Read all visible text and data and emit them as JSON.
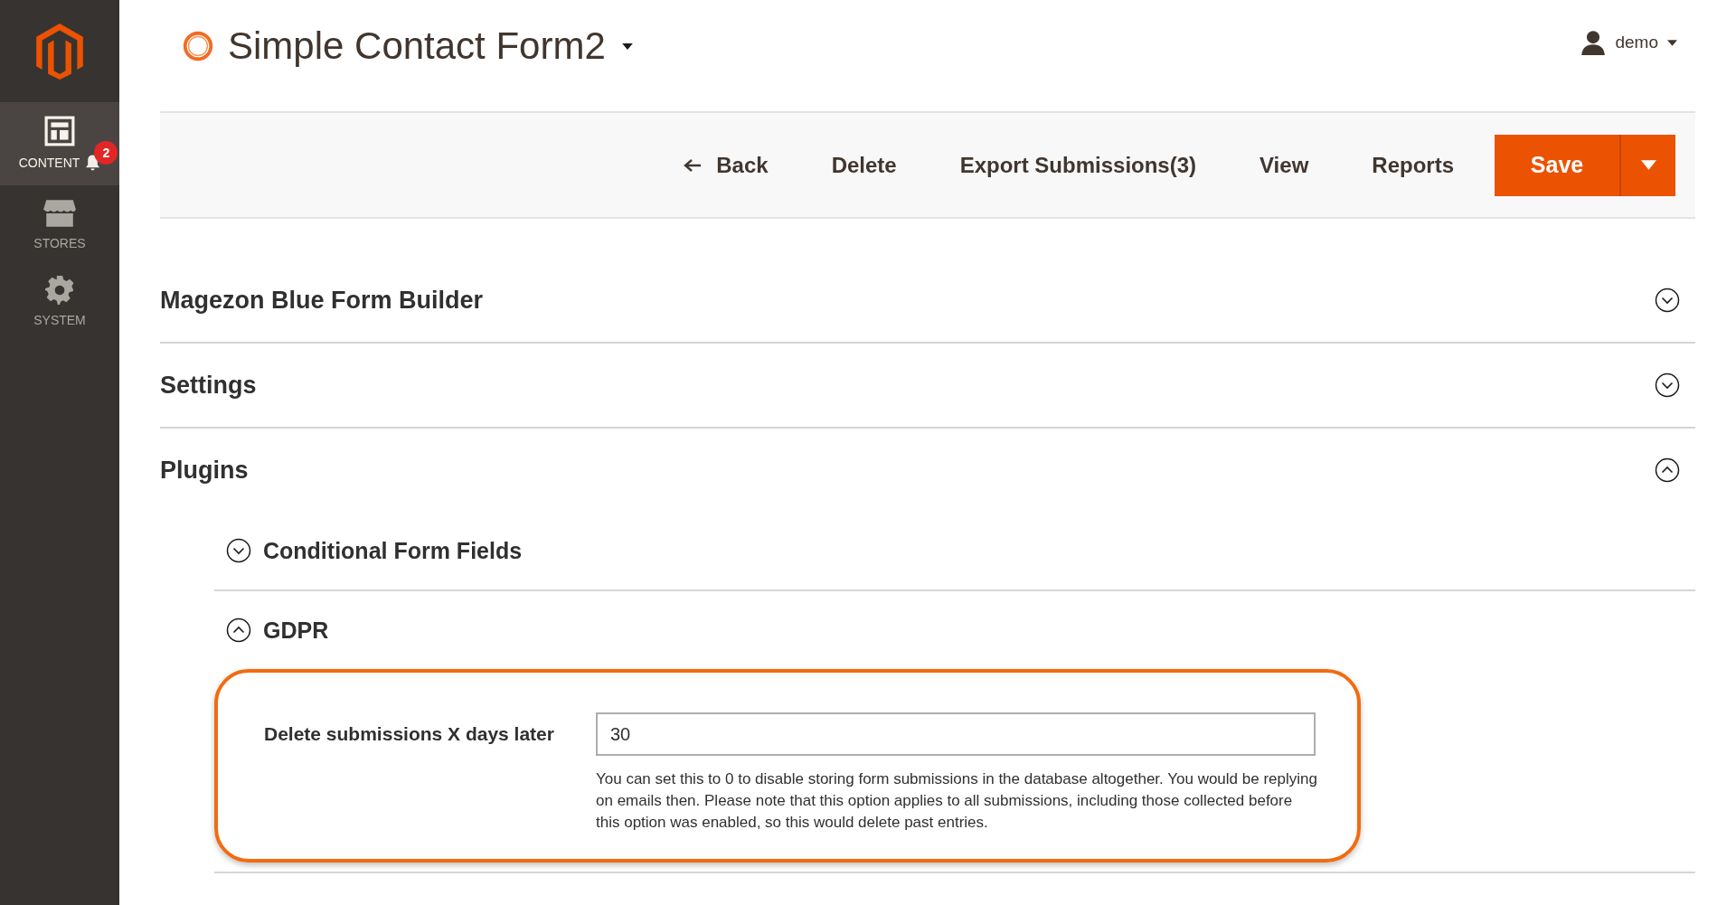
{
  "sidebar": {
    "items": [
      {
        "kind": "content",
        "label": "CONTENT",
        "selected": true,
        "badge": "2"
      },
      {
        "kind": "stores",
        "label": "STORES",
        "selected": false
      },
      {
        "kind": "system",
        "label": "SYSTEM",
        "selected": false
      }
    ]
  },
  "header": {
    "title": "Simple Contact Form2",
    "user": "demo"
  },
  "toolbar": {
    "buttons": [
      {
        "kind": "back",
        "label": "Back"
      },
      {
        "kind": "plain",
        "label": "Delete"
      },
      {
        "kind": "plain",
        "label": "Export Submissions(3)"
      },
      {
        "kind": "plain",
        "label": "View"
      },
      {
        "kind": "plain",
        "label": "Reports"
      }
    ],
    "primary": "Save"
  },
  "sections": [
    {
      "title": "Magezon Blue Form Builder",
      "expanded": false
    },
    {
      "title": "Settings",
      "expanded": false
    },
    {
      "title": "Plugins",
      "expanded": true,
      "children": [
        {
          "title": "Conditional Form Fields",
          "expanded": false
        },
        {
          "title": "GDPR",
          "expanded": true,
          "field": {
            "label": "Delete submissions X days later",
            "value": "30",
            "note": "You can set this to 0 to disable storing form submissions in the database altogether. You would be replying on emails then. Please note that this option applies to all submissions, including those collected before this option was enabled, so this would delete past entries."
          }
        }
      ]
    }
  ]
}
